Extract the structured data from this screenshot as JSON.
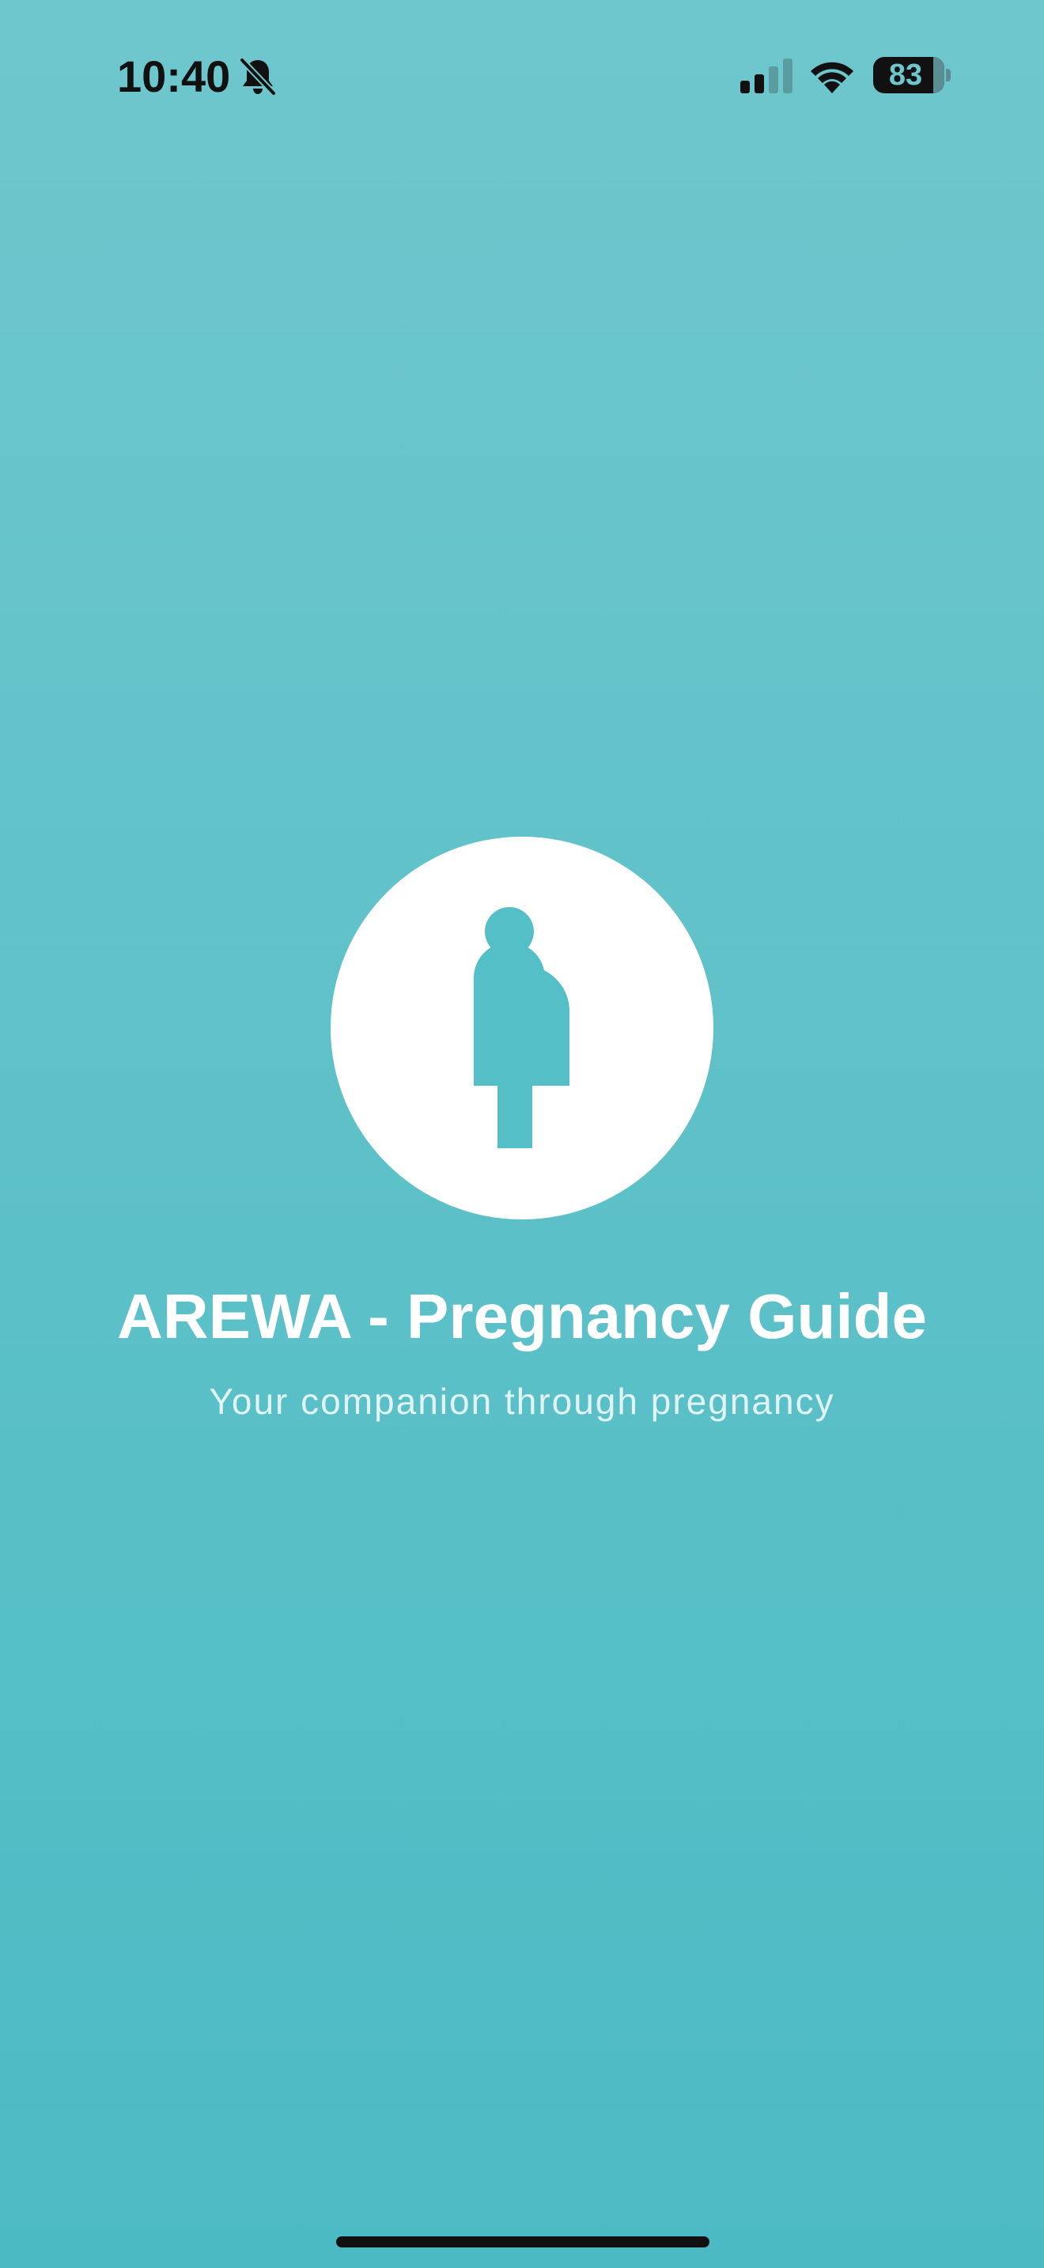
{
  "status_bar": {
    "time": "10:40",
    "battery_level": "83",
    "icons": [
      "bell-slash-icon",
      "cellular-signal-icon",
      "wifi-icon",
      "battery-icon"
    ]
  },
  "splash": {
    "logo_icon": "pregnant-woman-icon",
    "title": "AREWA - Pregnancy Guide",
    "subtitle": "Your companion through pregnancy"
  },
  "colors": {
    "background_top": "#6ec7cd",
    "background_bottom": "#4cbac4",
    "icon_fill": "#55bfc7",
    "logo_background": "#ffffff",
    "text": "#ffffff"
  }
}
